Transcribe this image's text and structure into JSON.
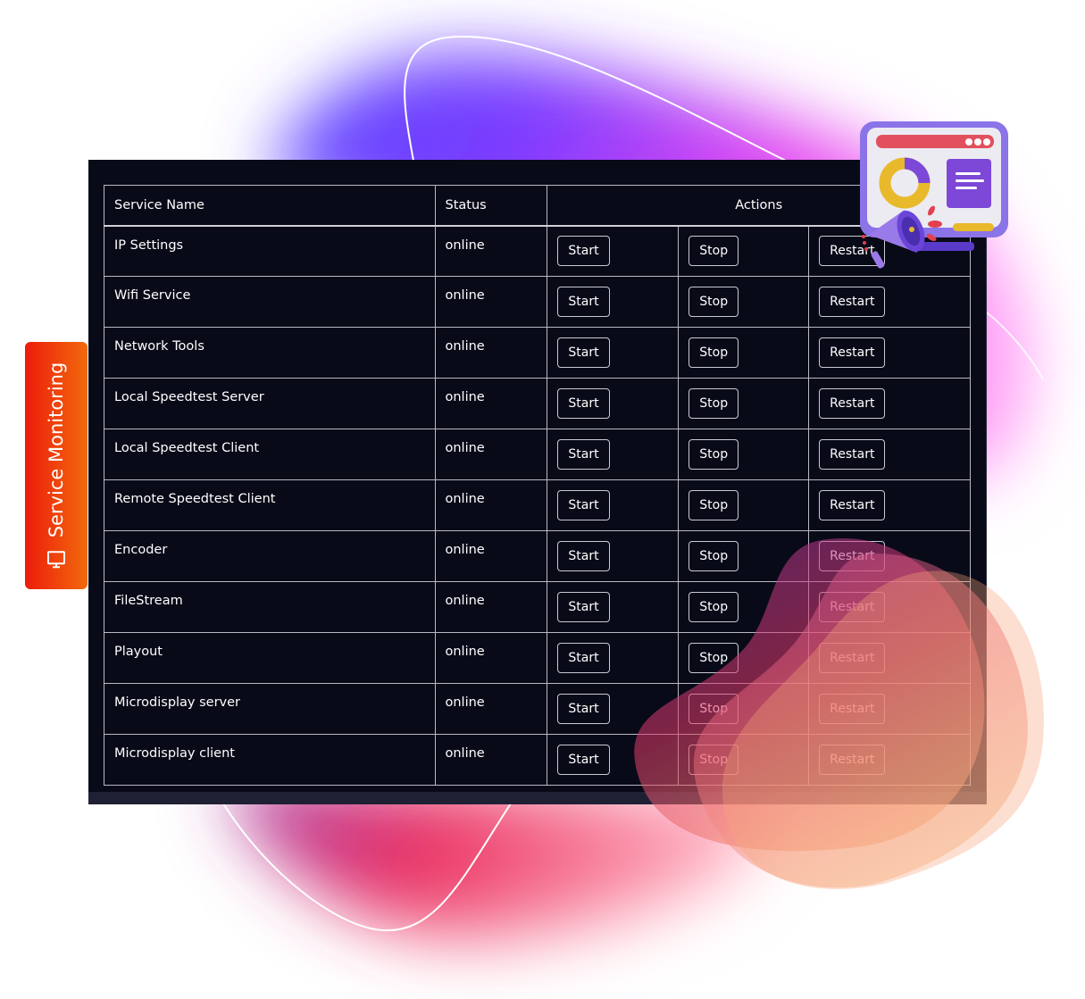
{
  "badge": {
    "label": "Service Monitoring",
    "icon": "monitor-icon",
    "gradient_start": "#ec1c0c",
    "gradient_end": "#f26a0c"
  },
  "table": {
    "headers": {
      "name": "Service Name",
      "status": "Status",
      "actions": "Actions"
    },
    "rows": [
      {
        "name": "IP Settings",
        "status": "online",
        "start": "Start",
        "stop": "Stop",
        "restart": "Restart"
      },
      {
        "name": "Wifi Service",
        "status": "online",
        "start": "Start",
        "stop": "Stop",
        "restart": "Restart"
      },
      {
        "name": "Network Tools",
        "status": "online",
        "start": "Start",
        "stop": "Stop",
        "restart": "Restart"
      },
      {
        "name": "Local Speedtest Server",
        "status": "online",
        "start": "Start",
        "stop": "Stop",
        "restart": "Restart"
      },
      {
        "name": "Local Speedtest Client",
        "status": "online",
        "start": "Start",
        "stop": "Stop",
        "restart": "Restart"
      },
      {
        "name": "Remote Speedtest Client",
        "status": "online",
        "start": "Start",
        "stop": "Stop",
        "restart": "Restart"
      },
      {
        "name": "Encoder",
        "status": "online",
        "start": "Start",
        "stop": "Stop",
        "restart": "Restart"
      },
      {
        "name": "FileStream",
        "status": "online",
        "start": "Start",
        "stop": "Stop",
        "restart": "Restart"
      },
      {
        "name": "Playout",
        "status": "online",
        "start": "Start",
        "stop": "Stop",
        "restart": "Restart"
      },
      {
        "name": "Microdisplay server",
        "status": "online",
        "start": "Start",
        "stop": "Stop",
        "restart": "Restart"
      },
      {
        "name": "Microdisplay client",
        "status": "online",
        "start": "Start",
        "stop": "Stop",
        "restart": "Restart"
      }
    ]
  },
  "decorations": {
    "illustration": "dashboard-megaphone-illustration",
    "colors": {
      "panel_bg": "#080a18",
      "blob_purple": "#6a3cff",
      "blob_magenta": "#e548f0",
      "blob_red": "#e8345f",
      "blob_orange": "#f4a070"
    }
  }
}
